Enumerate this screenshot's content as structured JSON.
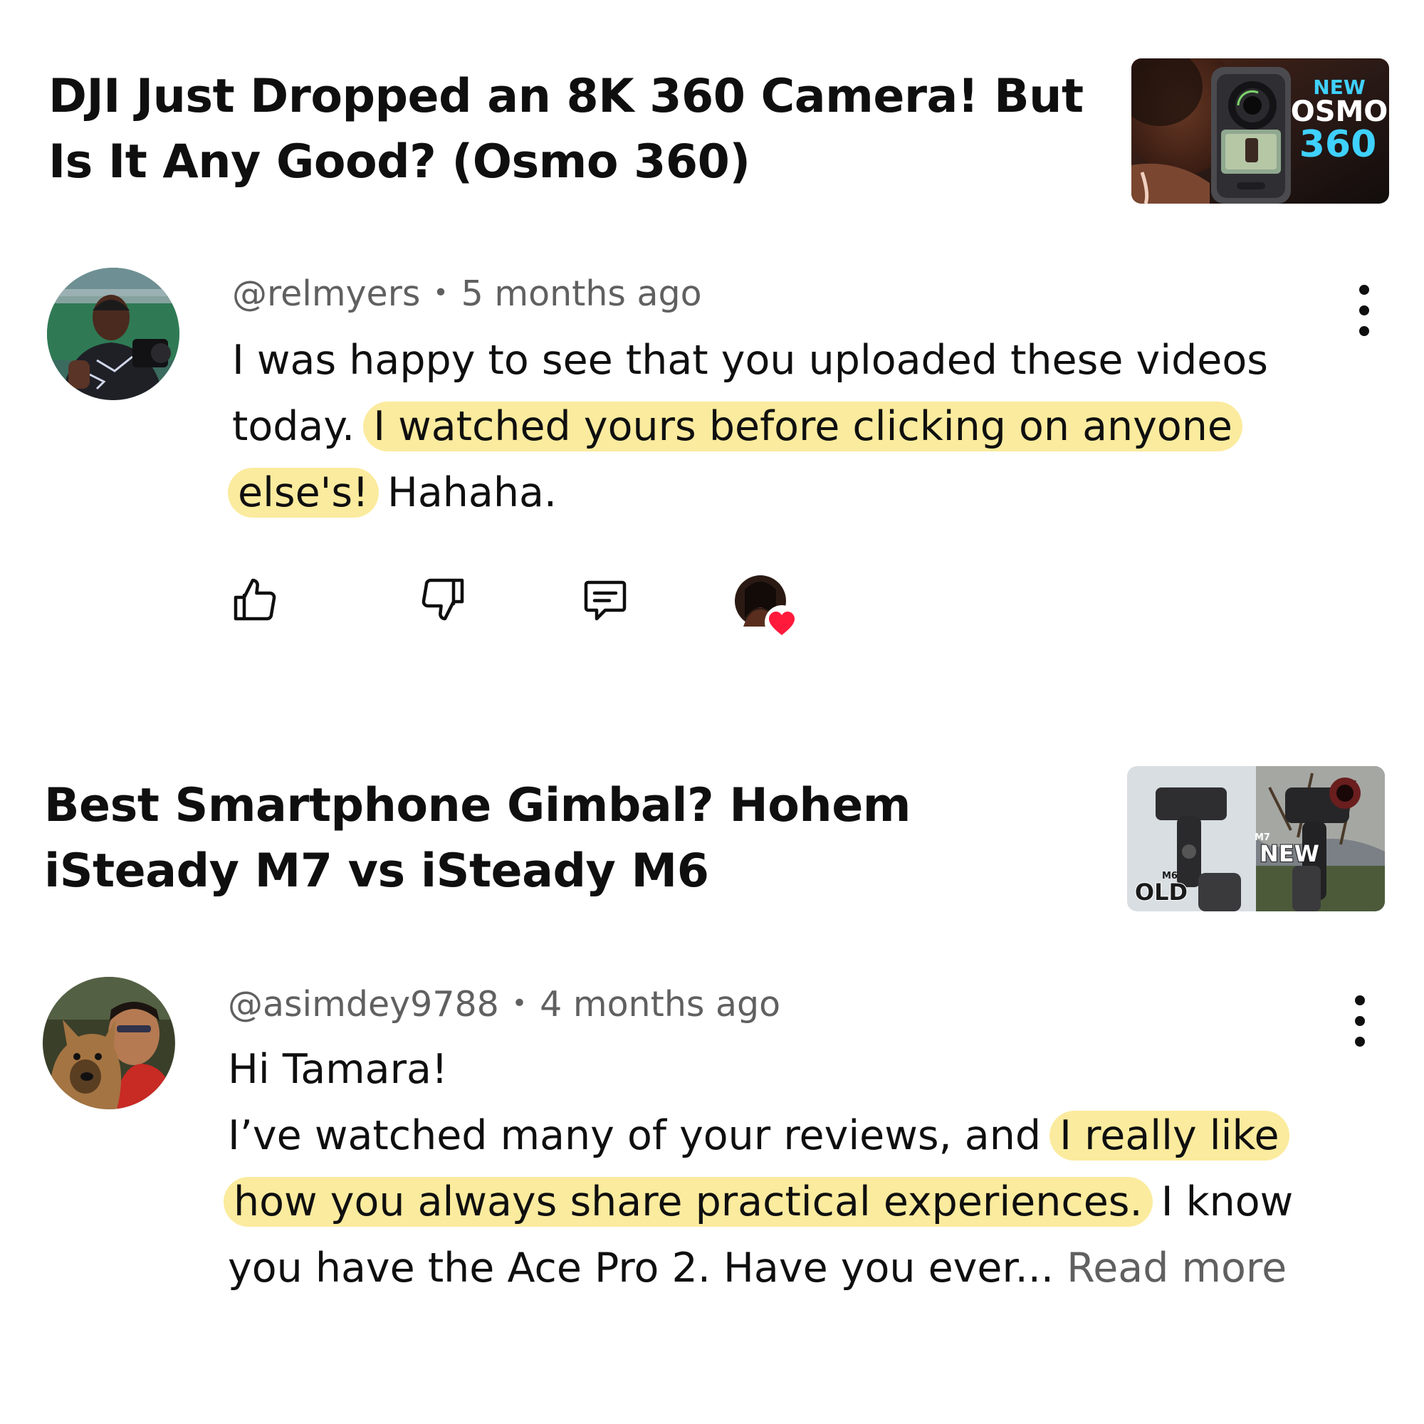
{
  "posts": [
    {
      "video_title": "DJI Just Dropped an 8K 360 Camera! But Is It Any Good? (Osmo 360)",
      "thumbnail": {
        "badge_new": "NEW",
        "badge_brand": "OSMO",
        "badge_model": "360",
        "accent_color": "#3fd1ff"
      },
      "comment": {
        "handle": "@relmyers",
        "separator": "•",
        "time": "5 months ago",
        "text_part1": "I was happy to see that you uploaded these videos today.",
        "highlight": "I watched yours before clicking on anyone else's!",
        "text_part2": "Hahaha."
      },
      "actions": {
        "like_icon": "thumbs-up-icon",
        "dislike_icon": "thumbs-down-icon",
        "reply_icon": "comment-icon",
        "creator_heart": "creator-heart-icon"
      }
    },
    {
      "video_title": "Best Smartphone Gimbal? Hohem iSteady M7 vs iSteady M6",
      "thumbnail": {
        "label_old_small": "M6",
        "label_old": "OLD",
        "label_new_small": "M7",
        "label_new": "NEW"
      },
      "comment": {
        "handle": "@asimdey9788",
        "separator": "•",
        "time": "4 months ago",
        "greeting": "Hi Tamara!",
        "text_part1": "I’ve watched many of your reviews, and",
        "highlight": "I really like how you always share practical experiences.",
        "text_part2": "I know you have the Ace Pro 2. Have you ever...",
        "read_more": "Read more"
      }
    }
  ],
  "colors": {
    "highlight": "#fbeb9e",
    "meta_text": "#606060",
    "heart": "#ff1a3c"
  }
}
